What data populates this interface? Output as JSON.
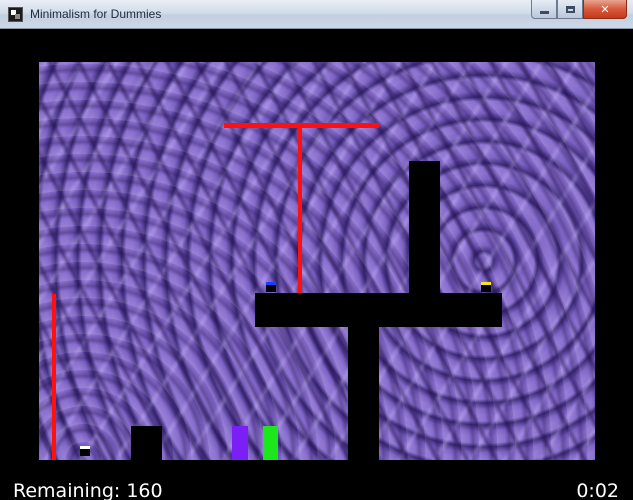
{
  "window": {
    "title": "Minimalism for Dummies",
    "icons": {
      "app": "app-icon",
      "minimize": "minimize-icon",
      "maximize": "maximize-icon",
      "close": "close-icon"
    },
    "close_glyph": "✕"
  },
  "hud": {
    "remaining_label": "Remaining:",
    "remaining_count": "160",
    "timer": "0:02"
  },
  "colors": {
    "laser": "#ff1010",
    "player_purple": "#7a1ff5",
    "player_green": "#1ce61c",
    "switch_blue": "#1a3cff",
    "switch_yellow": "#f5e61c",
    "switch_white": "#ffffff"
  }
}
